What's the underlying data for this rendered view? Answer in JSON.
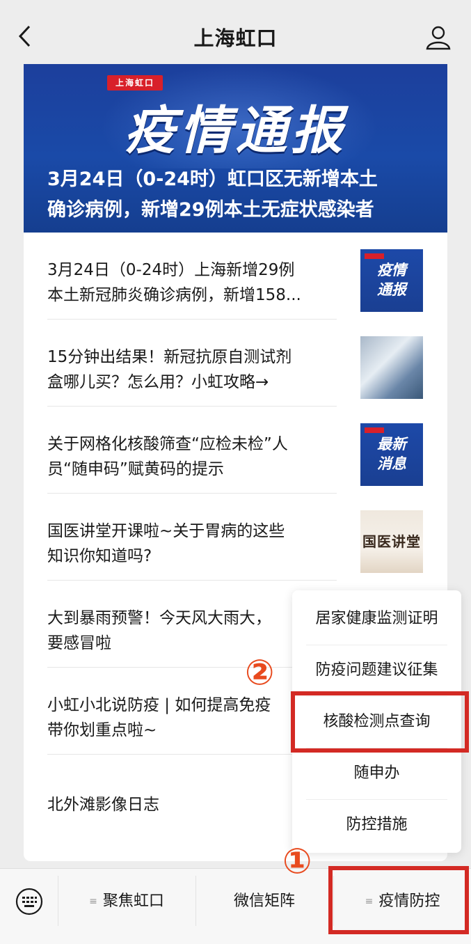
{
  "header": {
    "title": "上海虹口",
    "back_icon": "chevron-left-icon",
    "user_icon": "user-icon"
  },
  "banner": {
    "tag": "上海虹口",
    "headline": "疫情通报",
    "subtitle_line1": "3月24日（0-24时）虹口区无新增本土",
    "subtitle_line2": "确诊病例，新增29例本土无症状感染者"
  },
  "articles": [
    {
      "line1": "3月24日（0-24时）上海新增29例",
      "line2": "本土新冠肺炎确诊病例，新增158...",
      "thumb_text": "疫情\n通报",
      "thumb": "blue-bulletin"
    },
    {
      "line1": "15分钟出结果！新冠抗原自测试剂",
      "line2": "盒哪儿买？怎么用？小虹攻略→",
      "thumb": "photo-test-kits"
    },
    {
      "line1": "关于网格化核酸筛查“应检未检”人",
      "line2": "员“随申码”赋黄码的提示",
      "thumb_text": "最新\n消息",
      "thumb": "blue-news"
    },
    {
      "line1": "国医讲堂开课啦~关于胃病的这些",
      "line2": "知识你知道吗?",
      "thumb_text": "国医讲堂",
      "thumb": "book"
    },
    {
      "line1": "大到暴雨预警！今天风大雨大，",
      "line2": "要感冒啦"
    },
    {
      "line1": "小虹小北说防疫 | 如何提高免疫",
      "line2": "带你划重点啦~"
    },
    {
      "line1": "北外滩影像日志",
      "line2": ""
    }
  ],
  "popup_menu": {
    "items": [
      "居家健康监测证明",
      "防疫问题建议征集",
      "核酸检测点查询",
      "随申办",
      "防控措施"
    ],
    "highlighted_index": 2
  },
  "bottom_menu": {
    "keyboard_icon": "keyboard-icon",
    "tabs": [
      "聚焦虹口",
      "微信矩阵",
      "疫情防控"
    ],
    "highlighted_index": 2
  },
  "annotations": {
    "step1": "①",
    "step2": "②",
    "color": "#d32a24"
  }
}
